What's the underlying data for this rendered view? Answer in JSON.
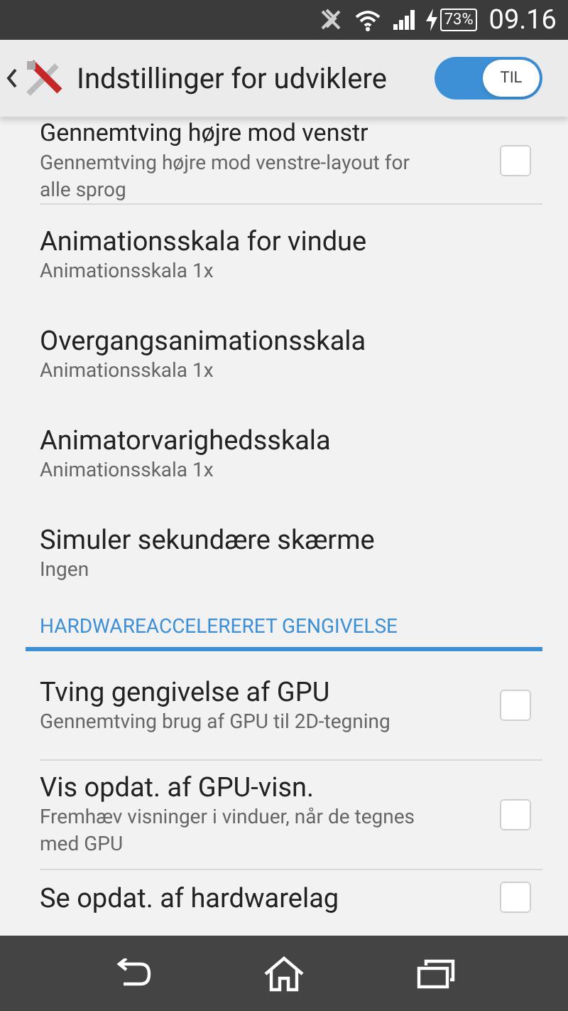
{
  "status_bar": {
    "battery": "73%",
    "time": "09.16"
  },
  "action_bar": {
    "title": "Indstillinger for udviklere",
    "switch": {
      "label": "TIL",
      "on": true
    }
  },
  "items": [
    {
      "kind": "checkbox",
      "title": "Gennemtving højre mod venstr",
      "subtitle": "Gennemtving højre mod venstre-layout for alle sprog",
      "checked": false
    },
    {
      "kind": "plain",
      "title": "Animationsskala for vindue",
      "subtitle": "Animationsskala 1x"
    },
    {
      "kind": "plain",
      "title": "Overgangsanimationsskala",
      "subtitle": "Animationsskala 1x"
    },
    {
      "kind": "plain",
      "title": "Animatorvarighedsskala",
      "subtitle": "Animationsskala 1x"
    },
    {
      "kind": "plain",
      "title": "Simuler sekundære skærme",
      "subtitle": "Ingen"
    },
    {
      "kind": "header",
      "title": "HARDWAREACCELERERET GENGIVELSE"
    },
    {
      "kind": "checkbox",
      "title": "Tving gengivelse af GPU",
      "subtitle": "Gennemtving brug af GPU til 2D-tegning",
      "checked": false
    },
    {
      "kind": "checkbox",
      "title": "Vis opdat. af GPU-visn.",
      "subtitle": "Fremhæv visninger i vinduer, når de tegnes med GPU",
      "checked": false
    },
    {
      "kind": "checkbox",
      "title": "Se opdat. af hardwarelag",
      "checked": false
    }
  ]
}
